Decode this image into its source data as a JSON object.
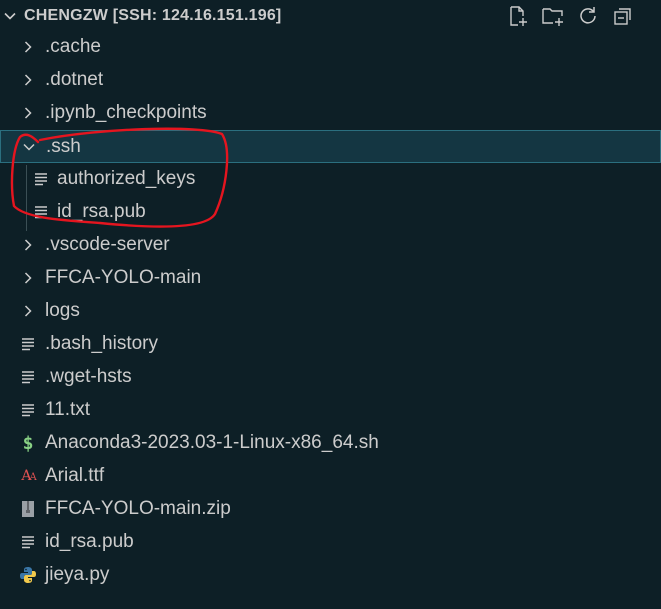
{
  "explorer": {
    "title": "CHENGZW [SSH: 124.16.151.196]",
    "actions": [
      {
        "icon": "new-file-icon"
      },
      {
        "icon": "new-folder-icon"
      },
      {
        "icon": "refresh-icon"
      },
      {
        "icon": "collapse-all-icon"
      }
    ]
  },
  "tree": [
    {
      "label": ".cache",
      "kind": "folder",
      "expanded": false,
      "depth": 0
    },
    {
      "label": ".dotnet",
      "kind": "folder",
      "expanded": false,
      "depth": 0
    },
    {
      "label": ".ipynb_checkpoints",
      "kind": "folder",
      "expanded": false,
      "depth": 0
    },
    {
      "label": ".ssh",
      "kind": "folder",
      "expanded": true,
      "depth": 0
    },
    {
      "label": "authorized_keys",
      "kind": "text-file",
      "depth": 1
    },
    {
      "label": "id_rsa.pub",
      "kind": "text-file",
      "depth": 1
    },
    {
      "label": ".vscode-server",
      "kind": "folder",
      "expanded": false,
      "depth": 0
    },
    {
      "label": "FFCA-YOLO-main",
      "kind": "folder",
      "expanded": false,
      "depth": 0
    },
    {
      "label": "logs",
      "kind": "folder",
      "expanded": false,
      "depth": 0
    },
    {
      "label": ".bash_history",
      "kind": "text-file",
      "depth": 0
    },
    {
      "label": ".wget-hsts",
      "kind": "text-file",
      "depth": 0
    },
    {
      "label": "11.txt",
      "kind": "text-file",
      "depth": 0
    },
    {
      "label": "Anaconda3-2023.03-1-Linux-x86_64.sh",
      "kind": "shell-file",
      "depth": 0
    },
    {
      "label": "Arial.ttf",
      "kind": "font-file",
      "depth": 0
    },
    {
      "label": "FFCA-YOLO-main.zip",
      "kind": "zip-file",
      "depth": 0
    },
    {
      "label": "id_rsa.pub",
      "kind": "text-file",
      "depth": 0
    },
    {
      "label": "jieya.py",
      "kind": "python-file",
      "depth": 0
    }
  ],
  "colors": {
    "background": "#0d1f26",
    "selection": "#143642",
    "focus_border": "#2b6f7f",
    "shell_icon": "#89d185",
    "font_icon": "#e05252",
    "python_blue": "#3b77a8",
    "python_yellow": "#f2c94c",
    "annotation_red": "#e5151f"
  }
}
